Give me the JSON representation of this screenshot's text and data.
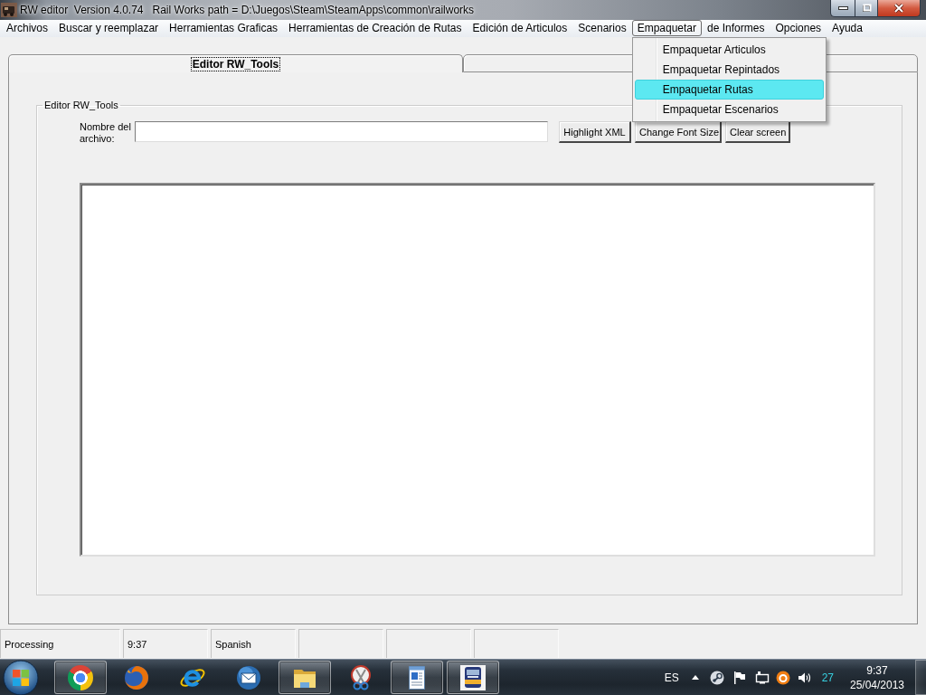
{
  "window": {
    "title": "RW editor  Version 4.0.74   Rail Works path = D:\\Juegos\\Steam\\SteamApps\\common\\railworks"
  },
  "menu_bar": {
    "items": [
      {
        "label": "Archivos",
        "selected": false
      },
      {
        "label": "Buscar y reemplazar",
        "selected": false
      },
      {
        "label": "Herramientas Graficas",
        "selected": false
      },
      {
        "label": "Herramientas de Creación de Rutas",
        "selected": false
      },
      {
        "label": "Edición de Articulos",
        "selected": false
      },
      {
        "label": "Scenarios",
        "selected": false
      },
      {
        "label": "Empaquetar",
        "selected": true,
        "menu": [
          {
            "label": "Empaquetar Articulos",
            "selected": false
          },
          {
            "label": "Empaquetar Repintados",
            "selected": false
          },
          {
            "label": "Empaquetar Rutas",
            "selected": true
          },
          {
            "label": "Empaquetar Escenarios",
            "selected": false
          }
        ]
      },
      {
        "label": "de Informes",
        "selected": false
      },
      {
        "label": "Opciones",
        "selected": false
      },
      {
        "label": "Ayuda",
        "selected": false
      }
    ]
  },
  "tabs": [
    {
      "label": "Editor RW_Tools",
      "selected": true,
      "focused": true
    },
    {
      "selected": false,
      "focused": false
    }
  ],
  "editor_group": {
    "title": "Editor RW_Tools",
    "file_label": "Nombre del archivo:",
    "buttons": [
      "Highlight XML",
      "Change Font Size",
      "Clear screen"
    ]
  },
  "status_bar": {
    "panels": [
      {
        "kind": "text",
        "text": "Processing"
      },
      {
        "kind": "text",
        "text": "9:37"
      },
      {
        "kind": "text",
        "text": "Spanish"
      },
      {
        "kind": "blank"
      },
      {
        "kind": "blank"
      },
      {
        "kind": "blank"
      }
    ]
  },
  "taskbar": {
    "apps": [
      {
        "kind": "chrome",
        "running": true
      },
      {
        "kind": "firefox",
        "running": false
      },
      {
        "kind": "ie",
        "running": false
      },
      {
        "kind": "mail",
        "running": false
      },
      {
        "kind": "files",
        "running": true
      },
      {
        "kind": "snipping",
        "running": false
      },
      {
        "kind": "wordpad",
        "running": true
      },
      {
        "kind": "game",
        "running": true
      }
    ],
    "tray": {
      "language": "ES",
      "indicator": "27",
      "time": "9:37",
      "date": "25/04/2013"
    }
  }
}
